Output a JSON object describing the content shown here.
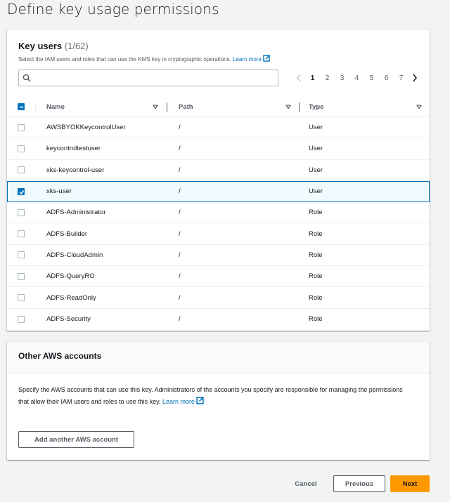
{
  "page": {
    "title": "Define key usage permissions"
  },
  "key_users": {
    "title": "Key users",
    "count": "(1/62)",
    "description": "Select the IAM users and roles that can use the KMS key in cryptographic operations.",
    "learn_more": "Learn more",
    "search": {
      "value": "",
      "placeholder": ""
    },
    "pagination": {
      "current_page": 1,
      "pages": [
        "1",
        "2",
        "3",
        "4",
        "5",
        "6",
        "7"
      ]
    },
    "columns": [
      "Name",
      "Path",
      "Type"
    ],
    "header_checkbox_state": "indeterminate",
    "rows": [
      {
        "name": "AWSBYOKKeycontrolUser",
        "path": "/",
        "type": "User",
        "selected": false
      },
      {
        "name": "keycontroltestuser",
        "path": "/",
        "type": "User",
        "selected": false
      },
      {
        "name": "xks-keycontrol-user",
        "path": "/",
        "type": "User",
        "selected": false
      },
      {
        "name": "xks-user",
        "path": "/",
        "type": "User",
        "selected": true
      },
      {
        "name": "ADFS-Administrator",
        "path": "/",
        "type": "Role",
        "selected": false
      },
      {
        "name": "ADFS-Builder",
        "path": "/",
        "type": "Role",
        "selected": false
      },
      {
        "name": "ADFS-CloudAdmin",
        "path": "/",
        "type": "Role",
        "selected": false
      },
      {
        "name": "ADFS-QueryRO",
        "path": "/",
        "type": "Role",
        "selected": false
      },
      {
        "name": "ADFS-ReadOnly",
        "path": "/",
        "type": "Role",
        "selected": false
      },
      {
        "name": "ADFS-Security",
        "path": "/",
        "type": "Role",
        "selected": false
      }
    ]
  },
  "other_accounts": {
    "title": "Other AWS accounts",
    "description": "Specify the AWS accounts that can use this key. Administrators of the accounts you specify are responsible for managing the permissions that allow their IAM users and roles to use this key.",
    "learn_more": "Learn more",
    "add_button": "Add another AWS account"
  },
  "footer": {
    "cancel": "Cancel",
    "previous": "Previous",
    "next": "Next"
  },
  "colors": {
    "accent": "#0073bb",
    "primary_button": "#ff9900",
    "page_bg": "#f2f3f3"
  },
  "icons": {
    "search": "search-icon",
    "external_link": "external-link-icon",
    "sort": "caret-down-icon",
    "prev_page": "chevron-left-icon",
    "next_page": "chevron-right-icon"
  }
}
